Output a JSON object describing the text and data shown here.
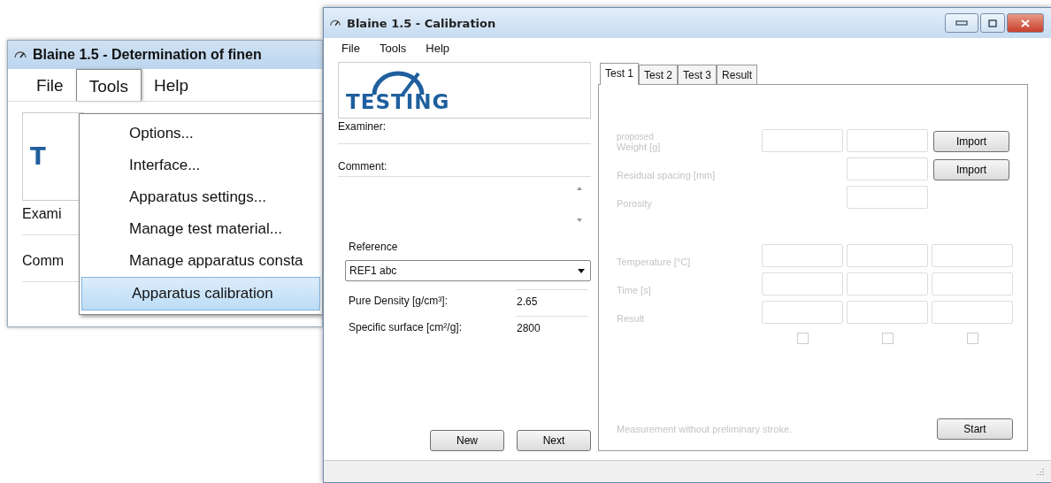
{
  "back_window": {
    "title": "Blaine 1.5 - Determination of finen",
    "menu": [
      {
        "label": "File",
        "selected": false
      },
      {
        "label": "Tools",
        "selected": true
      },
      {
        "label": "Help",
        "selected": false
      }
    ],
    "logo_text": "T",
    "examiner_label": "Exami",
    "comment_label": "Comm",
    "dropdown": [
      {
        "label": "Options...",
        "selected": false
      },
      {
        "label": "Interface...",
        "selected": false
      },
      {
        "label": "Apparatus settings...",
        "selected": false
      },
      {
        "label": "Manage test material...",
        "selected": false
      },
      {
        "label": "Manage apparatus consta",
        "selected": false
      },
      {
        "label": "Apparatus calibration",
        "selected": true
      }
    ]
  },
  "front_window": {
    "title": "Blaine 1.5 - Calibration",
    "menu": [
      "File",
      "Tools",
      "Help"
    ],
    "logo_text": "TESTING",
    "examiner_label": "Examiner:",
    "comment_label": "Comment:",
    "reference": {
      "label": "Reference",
      "value": "REF1 abc"
    },
    "properties": [
      {
        "label": "Pure Density [g/cm³]:",
        "value": "2.65"
      },
      {
        "label": "Specific surface [cm²/g]:",
        "value": "2800"
      }
    ],
    "buttons": [
      "New",
      "Next"
    ],
    "tabs": [
      {
        "label": "Test 1",
        "selected": true
      },
      {
        "label": "Test 2",
        "selected": false
      },
      {
        "label": "Test 3",
        "selected": false
      },
      {
        "label": "Result",
        "selected": false
      }
    ],
    "test_panel": {
      "disabled": true,
      "rows": [
        {
          "label_top": "proposed",
          "label": "Weight [g]",
          "cells": [
            {
              "kind": "field"
            },
            {
              "kind": "field"
            },
            {
              "kind": "button",
              "label": "Import"
            }
          ]
        },
        {
          "label": "Residual spacing [mm]",
          "cells": [
            {
              "kind": "empty"
            },
            {
              "kind": "field"
            },
            {
              "kind": "button",
              "label": "Import"
            }
          ]
        },
        {
          "label": "Porosity",
          "cells": [
            {
              "kind": "empty"
            },
            {
              "kind": "field"
            },
            {
              "kind": "empty"
            }
          ]
        },
        {
          "label": "Temperature [°C]",
          "cells": [
            {
              "kind": "field"
            },
            {
              "kind": "field"
            },
            {
              "kind": "field"
            }
          ]
        },
        {
          "label": "Time [s]",
          "cells": [
            {
              "kind": "field"
            },
            {
              "kind": "field"
            },
            {
              "kind": "field"
            }
          ]
        },
        {
          "label": "Result",
          "cells": [
            {
              "kind": "field"
            },
            {
              "kind": "field"
            },
            {
              "kind": "field"
            }
          ]
        }
      ],
      "checkboxes": [
        {
          "checked": false
        },
        {
          "checked": false
        },
        {
          "checked": false
        }
      ],
      "note": "Measurement without preliminary stroke.",
      "start_button": "Start"
    }
  }
}
